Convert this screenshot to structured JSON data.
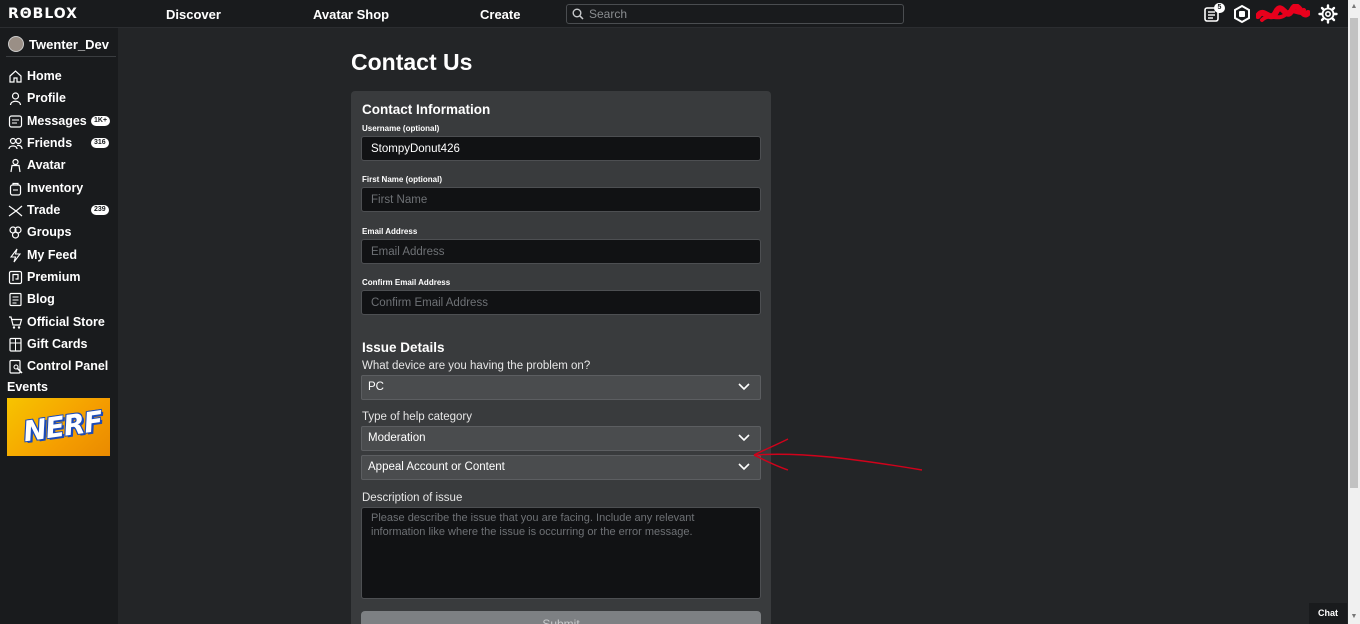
{
  "topbar": {
    "logo": "RΘBLOX",
    "nav": [
      "Discover",
      "Avatar Shop",
      "Create"
    ],
    "search_placeholder": "Search",
    "notification_count": "5",
    "icons": [
      "notifications-icon",
      "robux-icon",
      "settings-icon"
    ]
  },
  "sidebar": {
    "username": "Twenter_Dev",
    "items": [
      {
        "label": "Home",
        "icon": "home-icon"
      },
      {
        "label": "Profile",
        "icon": "profile-icon"
      },
      {
        "label": "Messages",
        "icon": "messages-icon",
        "badge": "1K+"
      },
      {
        "label": "Friends",
        "icon": "friends-icon",
        "badge": "316"
      },
      {
        "label": "Avatar",
        "icon": "avatar-icon"
      },
      {
        "label": "Inventory",
        "icon": "inventory-icon"
      },
      {
        "label": "Trade",
        "icon": "trade-icon",
        "badge": "239"
      },
      {
        "label": "Groups",
        "icon": "groups-icon"
      },
      {
        "label": "My Feed",
        "icon": "feed-icon"
      },
      {
        "label": "Premium",
        "icon": "premium-icon"
      },
      {
        "label": "Blog",
        "icon": "blog-icon"
      },
      {
        "label": "Official Store",
        "icon": "store-icon"
      },
      {
        "label": "Gift Cards",
        "icon": "gift-card-icon"
      },
      {
        "label": "Control Panel",
        "icon": "control-panel-icon"
      }
    ],
    "events_label": "Events",
    "events_banner_text": "NERF"
  },
  "main": {
    "title": "Contact Us",
    "contact": {
      "heading": "Contact Information",
      "username_label": "Username (optional)",
      "username_value": "StompyDonut426",
      "first_name_label": "First Name (optional)",
      "first_name_placeholder": "First Name",
      "email_label": "Email Address",
      "email_placeholder": "Email Address",
      "confirm_email_label": "Confirm Email Address",
      "confirm_email_placeholder": "Confirm Email Address"
    },
    "issue": {
      "heading": "Issue Details",
      "device_label": "What device are you having the problem on?",
      "device_value": "PC",
      "category_label": "Type of help category",
      "category_value": "Moderation",
      "subcategory_value": "Appeal Account or Content",
      "description_label": "Description of issue",
      "description_placeholder": "Please describe the issue that you are facing. Include any relevant information like where the issue is occurring or the error message.",
      "submit_label": "Submit"
    }
  },
  "chat_label": "Chat",
  "colors": {
    "background": "#232527",
    "nav": "#191b1d",
    "panel": "#393b3d",
    "annotation": "#d0021b"
  }
}
